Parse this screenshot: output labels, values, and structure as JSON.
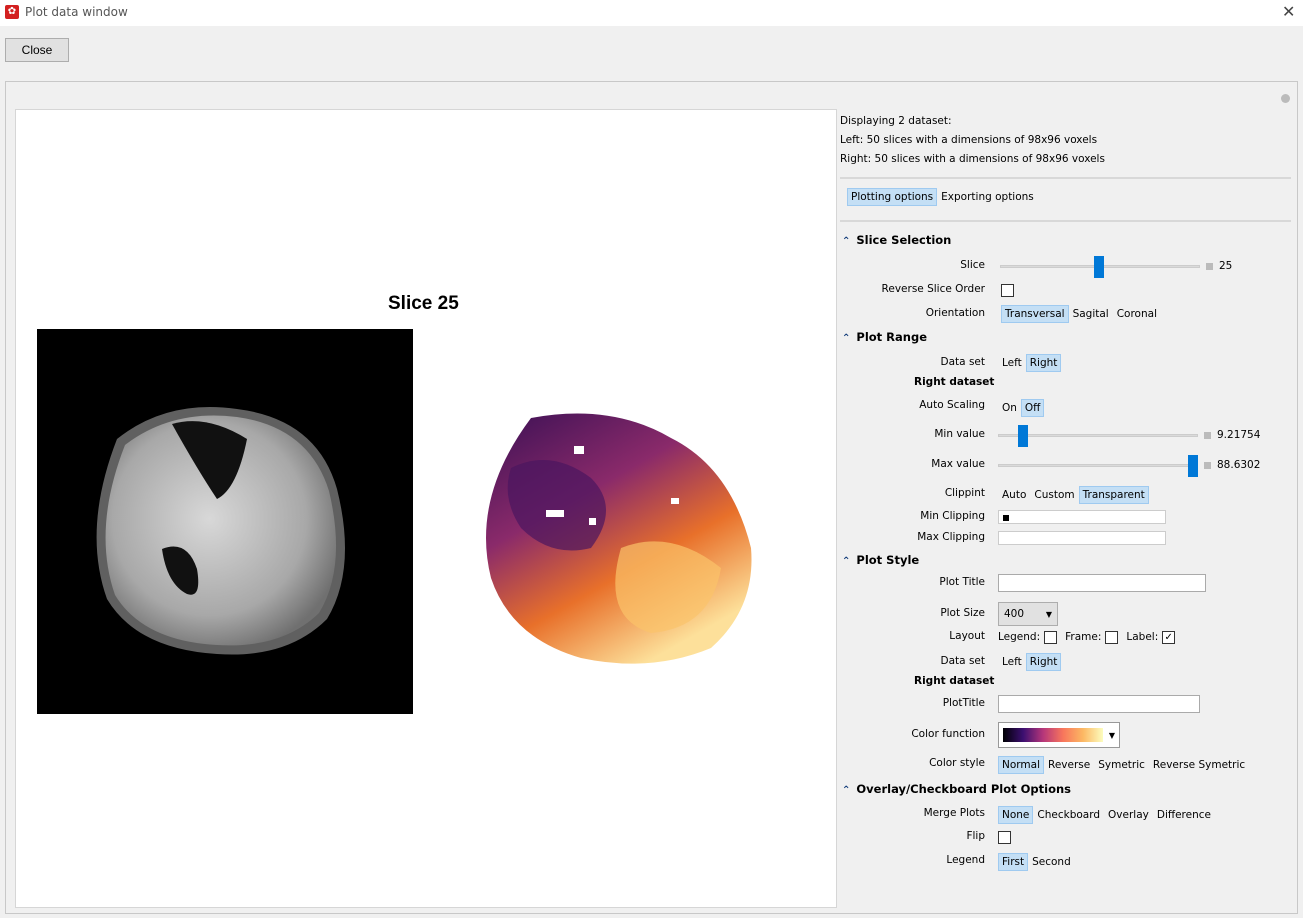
{
  "window": {
    "title": "Plot data window",
    "close_label": "Close"
  },
  "plot": {
    "title": "Slice 25"
  },
  "info": {
    "line1": "Displaying 2 dataset:",
    "line2": "Left: 50 slices with a dimensions of 98x96 voxels",
    "line3": "Right: 50 slices with a dimensions of 98x96 voxels"
  },
  "tabs": [
    {
      "label": "Plotting options",
      "selected": true
    },
    {
      "label": "Exporting options",
      "selected": false
    }
  ],
  "slice_selection": {
    "header": "Slice Selection",
    "slice_label": "Slice",
    "slice_value": "25",
    "slice_fraction": 0.5,
    "reverse_label": "Reverse Slice Order",
    "reverse_checked": false,
    "orientation_label": "Orientation",
    "orientations": [
      "Transversal",
      "Sagital",
      "Coronal"
    ],
    "orientation_selected": "Transversal"
  },
  "plot_range": {
    "header": "Plot Range",
    "dataset_label": "Data set",
    "datasets": [
      "Left",
      "Right"
    ],
    "dataset_selected": "Right",
    "subheader": "Right dataset",
    "autoscale_label": "Auto Scaling",
    "autoscale_options": [
      "On",
      "Off"
    ],
    "autoscale_selected": "Off",
    "min_label": "Min value",
    "min_value": "9.21754",
    "min_fraction": 0.12,
    "max_label": "Max value",
    "max_value": "88.6302",
    "max_fraction": 0.98,
    "clipping_label": "Clippint",
    "clipping_options": [
      "Auto",
      "Custom",
      "Transparent"
    ],
    "clipping_selected": "Transparent",
    "min_clip_label": "Min Clipping",
    "min_clip_color": "#000000",
    "max_clip_label": "Max Clipping"
  },
  "plot_style": {
    "header": "Plot Style",
    "title_label": "Plot Title",
    "title_value": "",
    "size_label": "Plot Size",
    "size_value": "400",
    "layout_label": "Layout",
    "legend_label": "Legend:",
    "legend_checked": false,
    "frame_label": "Frame:",
    "frame_checked": false,
    "label_label": "Label:",
    "label_checked": true,
    "dataset_label": "Data set",
    "datasets": [
      "Left",
      "Right"
    ],
    "dataset_selected": "Right",
    "subheader": "Right dataset",
    "plottitle_label": "PlotTitle",
    "plottitle_value": "",
    "color_function_label": "Color function",
    "color_style_label": "Color style",
    "color_styles": [
      "Normal",
      "Reverse",
      "Symetric",
      "Reverse Symetric"
    ],
    "color_style_selected": "Normal"
  },
  "overlay": {
    "header": "Overlay/Checkboard Plot Options",
    "merge_label": "Merge Plots",
    "merge_options": [
      "None",
      "Checkboard",
      "Overlay",
      "Difference"
    ],
    "merge_selected": "None",
    "flip_label": "Flip",
    "flip_checked": false,
    "legend_label": "Legend",
    "legend_options": [
      "First",
      "Second"
    ],
    "legend_selected": "First"
  },
  "colors": {
    "accent": "#0078d7",
    "selected_bg": "#c4dff5"
  }
}
